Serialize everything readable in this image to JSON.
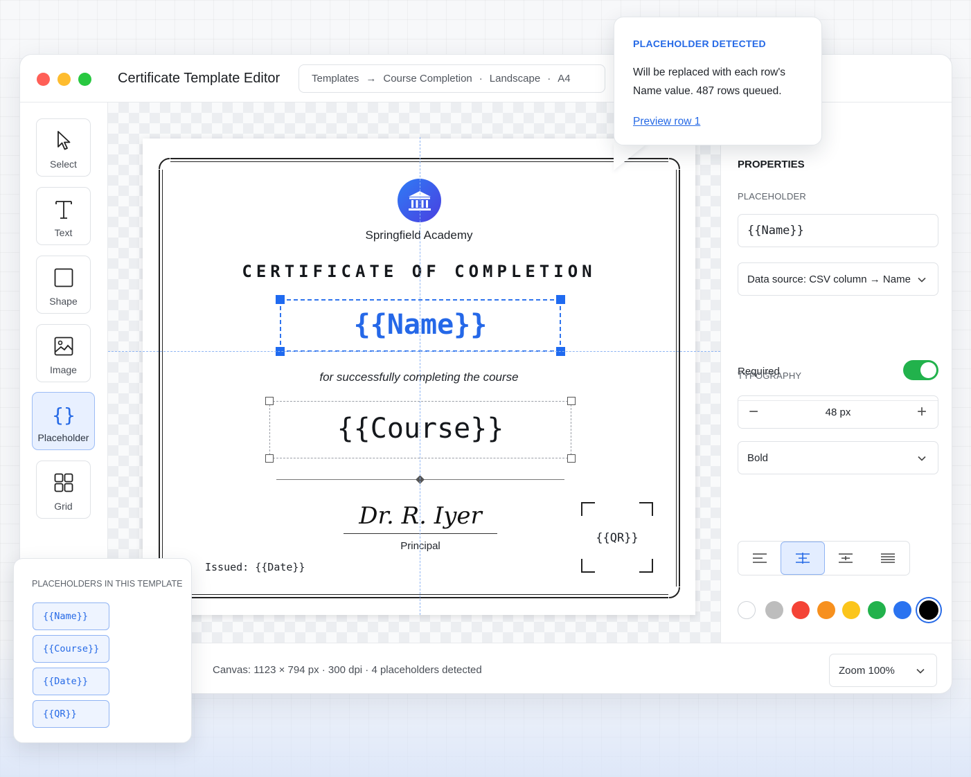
{
  "window": {
    "title": "Certificate Template Editor",
    "breadcrumb": [
      "Templates",
      "→",
      "Course Completion",
      "·",
      "Landscape",
      "·",
      "A4"
    ]
  },
  "toolbar": {
    "tools": [
      {
        "label": "Select",
        "icon": "cursor-icon"
      },
      {
        "label": "Text",
        "icon": "text-icon"
      },
      {
        "label": "Shape",
        "icon": "square-icon"
      },
      {
        "label": "Image",
        "icon": "image-icon"
      },
      {
        "label": "Placeholder",
        "icon": "braces-icon",
        "active": true
      },
      {
        "label": "Grid",
        "icon": "grid-icon"
      }
    ]
  },
  "certificate": {
    "org_name": "Springfield Academy",
    "title": "CERTIFICATE OF COMPLETION",
    "name_placeholder": "{{Name}}",
    "subtitle": "for successfully completing the course",
    "course_placeholder": "{{Course}}",
    "signature": "Dr. R. Iyer",
    "signer_role": "Principal",
    "issued": "Issued: {{Date}}",
    "qr_placeholder": "{{QR}}"
  },
  "tooltip": {
    "title": "PLACEHOLDER DETECTED",
    "body": "Will be replaced with each row's Name value. 487 rows queued.",
    "link": "Preview row 1"
  },
  "properties": {
    "title": "PROPERTIES",
    "placeholder_label": "PLACEHOLDER",
    "placeholder_value": "{{Name}}",
    "data_source": "Data source: CSV column → Name",
    "required_label": "Required",
    "required": true,
    "typography_label": "TYPOGRAPHY",
    "font_size": "48 px",
    "font_weight": "Bold",
    "alignment_options": [
      "left",
      "center",
      "center-alt",
      "justify"
    ],
    "alignment_selected": "center",
    "colors": [
      "#ffffff",
      "#bdbdbd",
      "#f44336",
      "#f7901e",
      "#fbc51b",
      "#22b24c",
      "#2a73f0",
      "#000000"
    ],
    "selected_color": "#000000"
  },
  "status": {
    "text": "Canvas:  1123 × 794 px  ·  300 dpi  ·  4 placeholders detected",
    "zoom": "Zoom 100%"
  },
  "placeholders_panel": {
    "title": "PLACEHOLDERS IN THIS TEMPLATE",
    "items": [
      "{{Name}}",
      "{{Course}}",
      "{{Date}}",
      "{{QR}}"
    ]
  }
}
